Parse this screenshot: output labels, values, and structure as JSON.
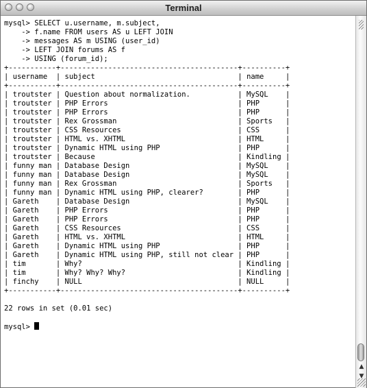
{
  "window": {
    "title": "Terminal"
  },
  "query": {
    "lines": [
      "mysql> SELECT u.username, m.subject,",
      "    -> f.name FROM users AS u LEFT JOIN",
      "    -> messages AS m USING (user_id)",
      "    -> LEFT JOIN forums AS f",
      "    -> USING (forum_id);"
    ]
  },
  "table": {
    "headers": [
      "username",
      "subject",
      "name"
    ],
    "rows": [
      [
        "troutster",
        "Question about normalization.",
        "MySQL"
      ],
      [
        "troutster",
        "PHP Errors",
        "PHP"
      ],
      [
        "troutster",
        "PHP Errors",
        "PHP"
      ],
      [
        "troutster",
        "Rex Grossman",
        "Sports"
      ],
      [
        "troutster",
        "CSS Resources",
        "CSS"
      ],
      [
        "troutster",
        "HTML vs. XHTML",
        "HTML"
      ],
      [
        "troutster",
        "Dynamic HTML using PHP",
        "PHP"
      ],
      [
        "troutster",
        "Because",
        "Kindling"
      ],
      [
        "funny man",
        "Database Design",
        "MySQL"
      ],
      [
        "funny man",
        "Database Design",
        "MySQL"
      ],
      [
        "funny man",
        "Rex Grossman",
        "Sports"
      ],
      [
        "funny man",
        "Dynamic HTML using PHP, clearer?",
        "PHP"
      ],
      [
        "Gareth",
        "Database Design",
        "MySQL"
      ],
      [
        "Gareth",
        "PHP Errors",
        "PHP"
      ],
      [
        "Gareth",
        "PHP Errors",
        "PHP"
      ],
      [
        "Gareth",
        "CSS Resources",
        "CSS"
      ],
      [
        "Gareth",
        "HTML vs. XHTML",
        "HTML"
      ],
      [
        "Gareth",
        "Dynamic HTML using PHP",
        "PHP"
      ],
      [
        "Gareth",
        "Dynamic HTML using PHP, still not clear",
        "PHP"
      ],
      [
        "tim",
        "Why?",
        "Kindling"
      ],
      [
        "tim",
        "Why? Why? Why?",
        "Kindling"
      ],
      [
        "finchy",
        "NULL",
        "NULL"
      ]
    ]
  },
  "summary": "22 rows in set (0.01 sec)",
  "prompt": "mysql>"
}
